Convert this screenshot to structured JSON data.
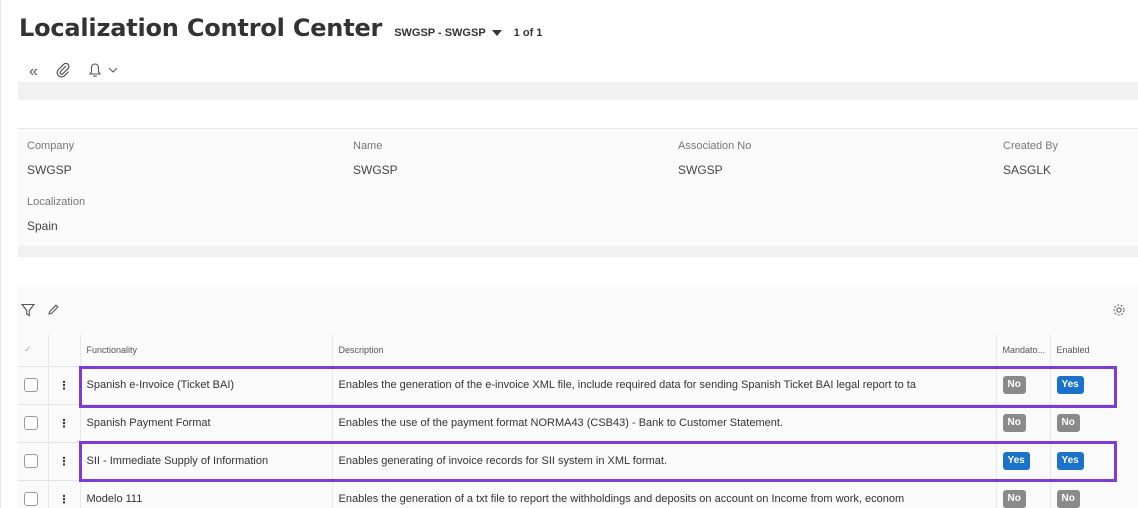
{
  "header": {
    "title": "Localization Control Center",
    "record_selector": "SWGSP - SWGSP",
    "record_counter": "1 of 1"
  },
  "toolbar_icons": [
    "double-chevron-left-icon",
    "paperclip-icon",
    "bell-icon",
    "chevron-down-icon"
  ],
  "details": {
    "company_label": "Company",
    "company_value": "SWGSP",
    "name_label": "Name",
    "name_value": "SWGSP",
    "association_label": "Association No",
    "association_value": "SWGSP",
    "created_by_label": "Created By",
    "created_by_value": "SASGLK",
    "localization_label": "Localization",
    "localization_value": "Spain"
  },
  "grid": {
    "columns": {
      "functionality": "Functionality",
      "description": "Description",
      "mandatory": "Mandato...",
      "enabled": "Enabled"
    },
    "rows": [
      {
        "functionality": "Spanish e-Invoice (Ticket BAI)",
        "description": "Enables the generation of the e-invoice XML file, include required data for sending Spanish Ticket BAI legal report to ta",
        "mandatory": "No",
        "enabled": "Yes"
      },
      {
        "functionality": "Spanish Payment Format",
        "description": "Enables the use of the payment format NORMA43 (CSB43) - Bank to Customer Statement.",
        "mandatory": "No",
        "enabled": "No"
      },
      {
        "functionality": "SII - Immediate Supply of Information",
        "description": "Enables generating of invoice records for SII system in XML format.",
        "mandatory": "Yes",
        "enabled": "Yes"
      },
      {
        "functionality": "Modelo 111",
        "description": "Enables the generation of a txt file to report the withholdings and deposits on account on Income from work, econom",
        "mandatory": "No",
        "enabled": "No"
      }
    ]
  },
  "colors": {
    "highlight": "#7e3bd7",
    "badge_yes": "#1a73c8",
    "badge_no": "#8a8a8a"
  }
}
